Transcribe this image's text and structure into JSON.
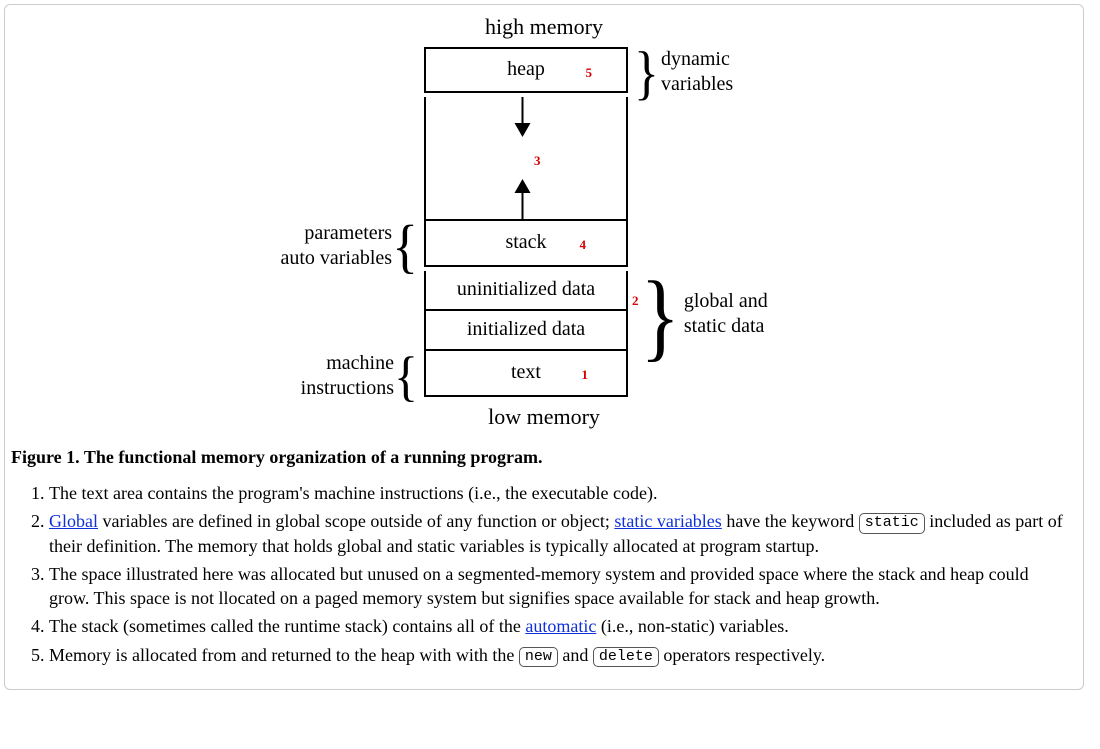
{
  "fig": {
    "top_label": "high memory",
    "bottom_label": "low memory",
    "segments": {
      "heap": "heap",
      "stack": "stack",
      "uninit": "uninitialized data",
      "init": "initialized data",
      "text": "text"
    },
    "numbers": {
      "heap": "5",
      "gap": "3",
      "stack": "4",
      "global": "2",
      "text": "1"
    },
    "left": {
      "params": "parameters\nauto variables",
      "machine": "machine\ninstructions"
    },
    "right": {
      "dynvars": "dynamic\nvariables",
      "global": "global and\nstatic data"
    }
  },
  "caption": "Figure 1. The functional memory organization of a running program.",
  "notes": {
    "i1": "The text area contains the program's machine instructions (i.e., the executable code).",
    "i2a": "Global",
    "i2b": " variables are defined in global scope outside of any function or object; ",
    "i2c": "static variables",
    "i2d": " have the keyword ",
    "i2e": "static",
    "i2f": " included as part of their definition. The memory that holds global and static variables is typically allocated at program startup.",
    "i3": "The space illustrated here was allocated but unused on a segmented-memory system and provided space where the stack and heap could grow. This space is not llocated on a paged memory system but signifies space available for stack and heap growth.",
    "i4a": "The stack (sometimes called the runtime stack) contains all of the ",
    "i4b": "automatic",
    "i4c": " (i.e., non-static) variables.",
    "i5a": "Memory is allocated from and returned to the heap with with the ",
    "i5b": "new",
    "i5c": " and ",
    "i5d": "delete",
    "i5e": " operators respectively."
  }
}
